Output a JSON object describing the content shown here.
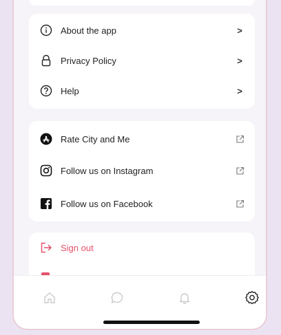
{
  "sections": {
    "about": {
      "items": [
        {
          "label": "About the app",
          "icon": "info-icon",
          "trail": ">"
        },
        {
          "label": "Privacy Policy",
          "icon": "lock-icon",
          "trail": ">"
        },
        {
          "label": "Help",
          "icon": "help-icon",
          "trail": ">"
        }
      ]
    },
    "social": {
      "items": [
        {
          "label": "Rate City and Me",
          "icon": "app-store-icon",
          "trail": "external-link-icon"
        },
        {
          "label": "Follow us on Instagram",
          "icon": "instagram-icon",
          "trail": "external-link-icon"
        },
        {
          "label": "Follow us on Facebook",
          "icon": "facebook-icon",
          "trail": "external-link-icon"
        }
      ]
    },
    "account": {
      "items": [
        {
          "label": "Sign out",
          "icon": "sign-out-icon"
        }
      ]
    }
  },
  "tabbar": {
    "tabs": [
      {
        "icon": "home-icon",
        "active": false
      },
      {
        "icon": "chat-icon",
        "active": false
      },
      {
        "icon": "bell-icon",
        "active": false
      },
      {
        "icon": "gear-icon",
        "active": true
      }
    ]
  },
  "colors": {
    "background": "#ece3f2",
    "screen": "#f6f4f8",
    "card": "#ffffff",
    "danger": "#e5506b",
    "text": "#222222",
    "inactive_tab": "#c9c9c9",
    "active_tab": "#222222"
  }
}
